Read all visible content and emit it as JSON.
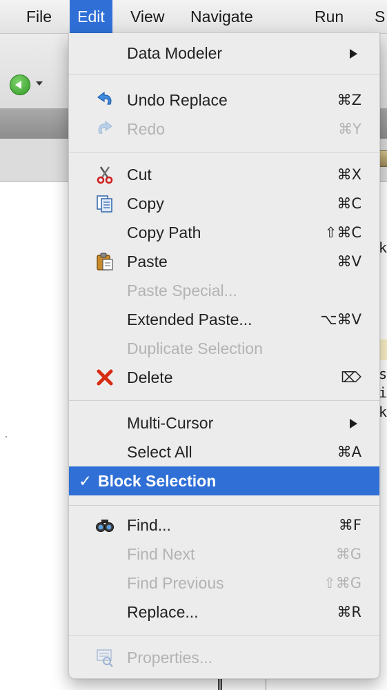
{
  "menubar": {
    "items": [
      "File",
      "Edit",
      "View",
      "Navigate",
      "Run",
      "S"
    ],
    "active_index": 1
  },
  "background_text": {
    "chars": [
      "k",
      "s",
      "i",
      "k"
    ]
  },
  "menu": {
    "data_modeler": {
      "label": "Data Modeler"
    },
    "undo": {
      "label": "Undo Replace",
      "shortcut": "⌘Z"
    },
    "redo": {
      "label": "Redo",
      "shortcut": "⌘Y"
    },
    "cut": {
      "label": "Cut",
      "shortcut": "⌘X"
    },
    "copy": {
      "label": "Copy",
      "shortcut": "⌘C"
    },
    "copy_path": {
      "label": "Copy Path",
      "shortcut": "⇧⌘C"
    },
    "paste": {
      "label": "Paste",
      "shortcut": "⌘V"
    },
    "paste_special": {
      "label": "Paste Special..."
    },
    "extended_paste": {
      "label": "Extended Paste...",
      "shortcut": "⌥⌘V"
    },
    "duplicate_selection": {
      "label": "Duplicate Selection"
    },
    "delete": {
      "label": "Delete",
      "shortcut": "⌦"
    },
    "multi_cursor": {
      "label": "Multi-Cursor"
    },
    "select_all": {
      "label": "Select All",
      "shortcut": "⌘A"
    },
    "block_selection": {
      "label": "Block Selection",
      "check": "✓"
    },
    "find": {
      "label": "Find...",
      "shortcut": "⌘F"
    },
    "find_next": {
      "label": "Find Next",
      "shortcut": "⌘G"
    },
    "find_previous": {
      "label": "Find Previous",
      "shortcut": "⇧⌘G"
    },
    "replace": {
      "label": "Replace...",
      "shortcut": "⌘R"
    },
    "properties": {
      "label": "Properties..."
    }
  },
  "colors": {
    "selection": "#2f6fd6",
    "menu_background": "#ececec",
    "disabled_text": "#b3b3b3"
  }
}
